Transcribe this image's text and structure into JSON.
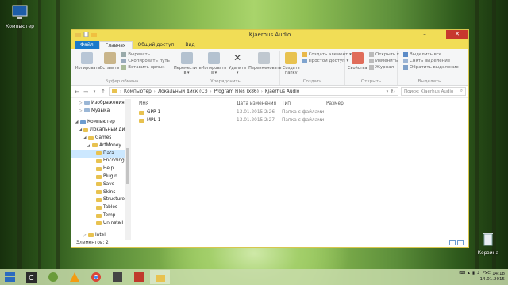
{
  "desktop": {
    "computer_icon_label": "Компьютер",
    "recycle_label": "Корзина"
  },
  "window": {
    "title": "Kjaerhus Audio",
    "tabs": [
      "Файл",
      "Главная",
      "Общий доступ",
      "Вид"
    ],
    "ribbon": {
      "clipboard": {
        "copy": "Копировать",
        "paste": "Вставить",
        "cut": "Вырезать",
        "copy_path": "Скопировать путь",
        "paste_shortcut": "Вставить ярлык",
        "label": "Буфер обмена"
      },
      "organize": {
        "move": "Переместить в ▾",
        "copy_to": "Копировать в ▾",
        "delete": "Удалить ▾",
        "rename": "Переименовать",
        "label": "Упорядочить"
      },
      "create": {
        "new_folder": "Создать папку",
        "new_item": "Создать элемент ▾",
        "easy_access": "Простой доступ ▾",
        "label": "Создать"
      },
      "open": {
        "properties": "Свойства",
        "open": "Открыть ▾",
        "edit": "Изменить",
        "history": "Журнал",
        "label": "Открыть"
      },
      "select": {
        "select_all": "Выделить все",
        "select_none": "Снять выделение",
        "invert": "Обратить выделение",
        "label": "Выделить"
      }
    },
    "address": {
      "crumbs": [
        "Компьютер",
        "Локальный диск (C:)",
        "Program Files (x86)",
        "Kjaerhus Audio"
      ],
      "search_placeholder": "Поиск: Kjaerhus Audio"
    },
    "nav_tree": [
      {
        "label": "Изображения",
        "indent": 1,
        "arrow": "▷"
      },
      {
        "label": "Музыка",
        "indent": 1,
        "arrow": "▷"
      },
      {
        "label": "",
        "indent": 0,
        "arrow": ""
      },
      {
        "label": "Компьютер",
        "indent": 0,
        "arrow": "◢"
      },
      {
        "label": "Локальный диск",
        "indent": 1,
        "arrow": "◢"
      },
      {
        "label": "Games",
        "indent": 2,
        "arrow": "◢"
      },
      {
        "label": "ArtMoney",
        "indent": 3,
        "arrow": "◢"
      },
      {
        "label": "Data",
        "indent": 4,
        "arrow": "",
        "selected": true
      },
      {
        "label": "Encoding",
        "indent": 4,
        "arrow": ""
      },
      {
        "label": "Help",
        "indent": 4,
        "arrow": ""
      },
      {
        "label": "Plugin",
        "indent": 4,
        "arrow": ""
      },
      {
        "label": "Save",
        "indent": 4,
        "arrow": ""
      },
      {
        "label": "Skins",
        "indent": 4,
        "arrow": ""
      },
      {
        "label": "Structure",
        "indent": 4,
        "arrow": ""
      },
      {
        "label": "Tables",
        "indent": 4,
        "arrow": ""
      },
      {
        "label": "Temp",
        "indent": 4,
        "arrow": ""
      },
      {
        "label": "Uninstall",
        "indent": 4,
        "arrow": ""
      },
      {
        "label": "",
        "indent": 0,
        "arrow": ""
      },
      {
        "label": "Intel",
        "indent": 2,
        "arrow": "▷"
      }
    ],
    "columns": {
      "name": "Имя",
      "date": "Дата изменения",
      "type": "Тип",
      "size": "Размер"
    },
    "files": [
      {
        "name": "GPP-1",
        "date": "13.01.2015 2:26",
        "type": "Папка с файлами",
        "size": ""
      },
      {
        "name": "MPL-1",
        "date": "13.01.2015 2:27",
        "type": "Папка с файлами",
        "size": ""
      }
    ],
    "status": "Элементов: 2"
  },
  "taskbar": {
    "lang": "РУС",
    "time": "14:18",
    "date": "14.01.2015"
  },
  "colors": {
    "titlebar": "#f1dd56",
    "file_tab": "#1979ca",
    "close": "#c7382e",
    "folder": "#e8c250",
    "selection": "#cce8ff"
  }
}
